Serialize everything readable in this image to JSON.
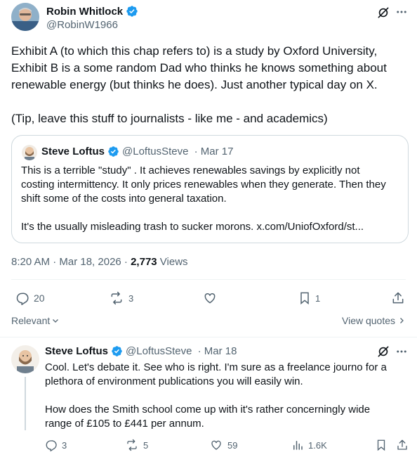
{
  "main_tweet": {
    "author_name": "Robin Whitlock",
    "handle": "@RobinW1966",
    "text_p1_l1": "Exhibit A (to which this chap refers to) is a study by Oxford University,",
    "text_p1_l2": "Exhibit B is a some random Dad who thinks he knows something about",
    "text_p1_l3": "renewable energy (but thinks he does). Just another typical day on X.",
    "text_p2": "(Tip, leave this stuff to journalists - like me - and academics)",
    "timestamp": "8:20 AM · Mar 18, 2026 · ",
    "views_count": "2,773",
    "views_label": " Views",
    "replies": "20",
    "reposts": "3",
    "bookmarks": "1"
  },
  "quoted_tweet": {
    "author_name": "Steve Loftus",
    "handle": "@LoftusSteve",
    "date": " · Mar 17",
    "line1": "This is a terrible \"study\" . It achieves renewables savings by explicitly not",
    "line2": "costing intermittency. It only prices renewables when they generate. Then they",
    "line3": "shift some of the costs into general taxation.",
    "line4": "It's the usually misleading trash to sucker morons. x.com/UniofOxford/st..."
  },
  "filter_bar": {
    "relevant_label": "Relevant",
    "view_quotes_label": "View quotes"
  },
  "reply": {
    "author_name": "Steve Loftus",
    "handle": "@LoftusSteve",
    "date": " · Mar 18",
    "line1": "Cool. Let's debate it. See who is right. I'm sure as a freelance journo for a",
    "line2": "plethora of environment publications you will easily win.",
    "line3": "How does the Smith school come up with it's rather concerningly wide",
    "line4": "range of £105 to £441 per annum.",
    "replies": "3",
    "reposts": "5",
    "likes": "59",
    "views": "1.6K"
  },
  "colors": {
    "verified": "#1d9bf0",
    "text": "#0f1419",
    "muted": "#536471",
    "border": "#cfd9de"
  }
}
